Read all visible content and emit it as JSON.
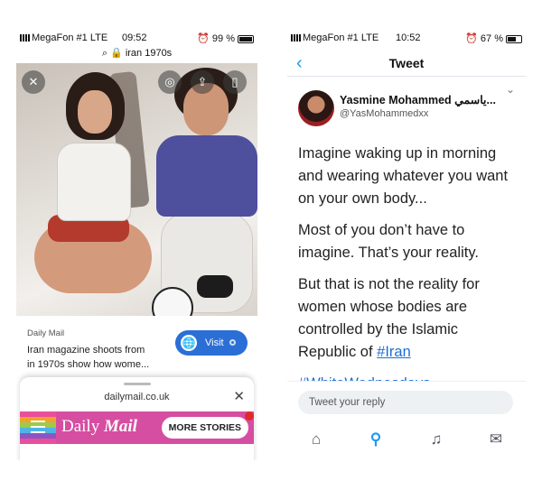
{
  "left": {
    "status": {
      "carrier": "MegaFon #1 LTE",
      "time": "09:52",
      "battery": "99 %"
    },
    "url": "iran 1970s",
    "card": {
      "source": "Daily Mail",
      "headline_line1": "Iran magazine shoots from",
      "headline_line2": "in 1970s show how wome...",
      "visit_label": "Visit"
    },
    "sheet": {
      "domain": "dailymail.co.uk",
      "brand_light": "Daily",
      "brand_bold": "Mail",
      "more_label": "MORE STORIES"
    },
    "icons": [
      "close-icon",
      "lens-icon",
      "share-icon",
      "bookmark-icon",
      "globe-icon",
      "menu-icon"
    ],
    "battery_level": 0.99
  },
  "right": {
    "status": {
      "carrier": "MegaFon #1 LTE",
      "time": "10:52",
      "battery": "67 %"
    },
    "nav": {
      "title": "Tweet"
    },
    "tweet": {
      "name": "Yasmine Mohammed ياسمي...",
      "handle": "@YasMohammedxx",
      "p1": "Imagine waking up in morning and wearing whatever you want on your own body...",
      "p2": "Most of you don’t have to imagine. That’s your reality.",
      "p3_prefix": "But that is not the reality for women whose bodies are controlled by the Islamic Republic of ",
      "p3_link": "#Iran",
      "hashtag": "#WhiteWednesdays"
    },
    "reply_placeholder": "Tweet your reply",
    "tabs": [
      "home-icon",
      "search-icon",
      "notifications-icon",
      "messages-icon"
    ],
    "battery_level": 0.67
  },
  "colors": {
    "twitter_blue": "#1d9bf0",
    "visit_blue": "#2b6fd6",
    "dailymail_pink": "#d64ea1"
  }
}
